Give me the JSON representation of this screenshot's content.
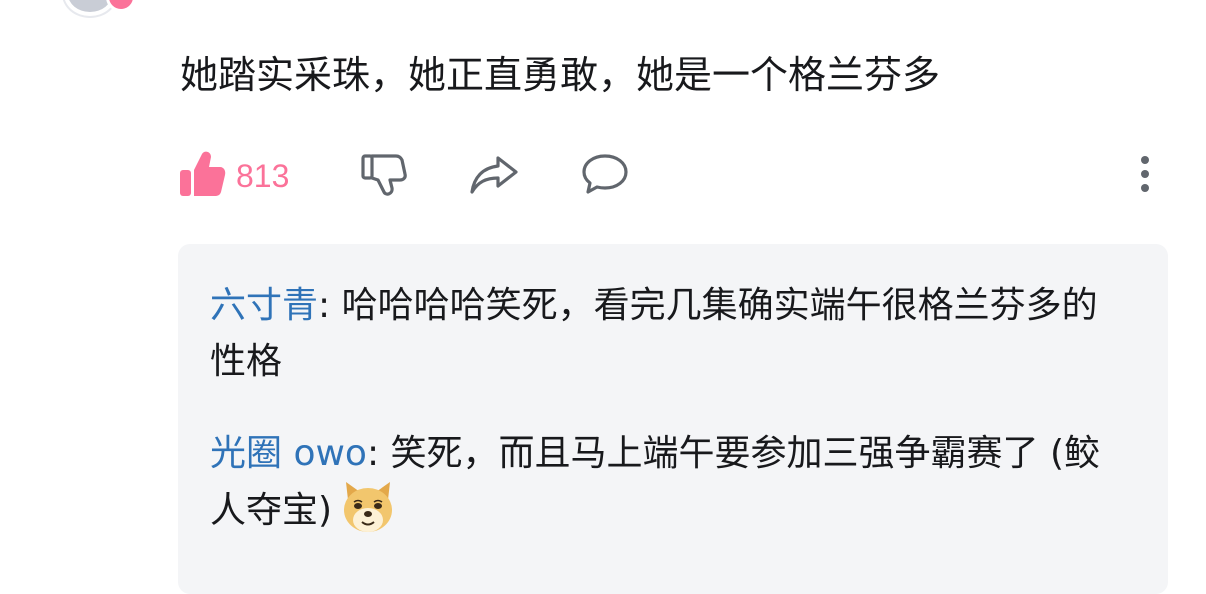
{
  "comment": {
    "text": "她踏实采珠，她正直勇敢，她是一个格兰芬多",
    "like_count": "813",
    "accent_color": "#fb7299"
  },
  "actions": {
    "like_icon": "thumbs-up-icon",
    "dislike_icon": "thumbs-down-icon",
    "share_icon": "share-icon",
    "reply_icon": "reply-bubble-icon",
    "more_icon": "more-vertical-icon"
  },
  "replies": [
    {
      "user": "六寸青",
      "separator": ": ",
      "text": "哈哈哈哈笑死，看完几集确实端午很格兰芬多的性格"
    },
    {
      "user": "光圈 owo",
      "separator": ": ",
      "text": "笑死，而且马上端午要参加三强争霸赛了 (鲛人夺宝)",
      "emoji": "doge-emoji-icon"
    }
  ],
  "colors": {
    "username": "#2f73b8",
    "reply_bg": "#f4f5f7",
    "icon_gray": "#61666d"
  }
}
